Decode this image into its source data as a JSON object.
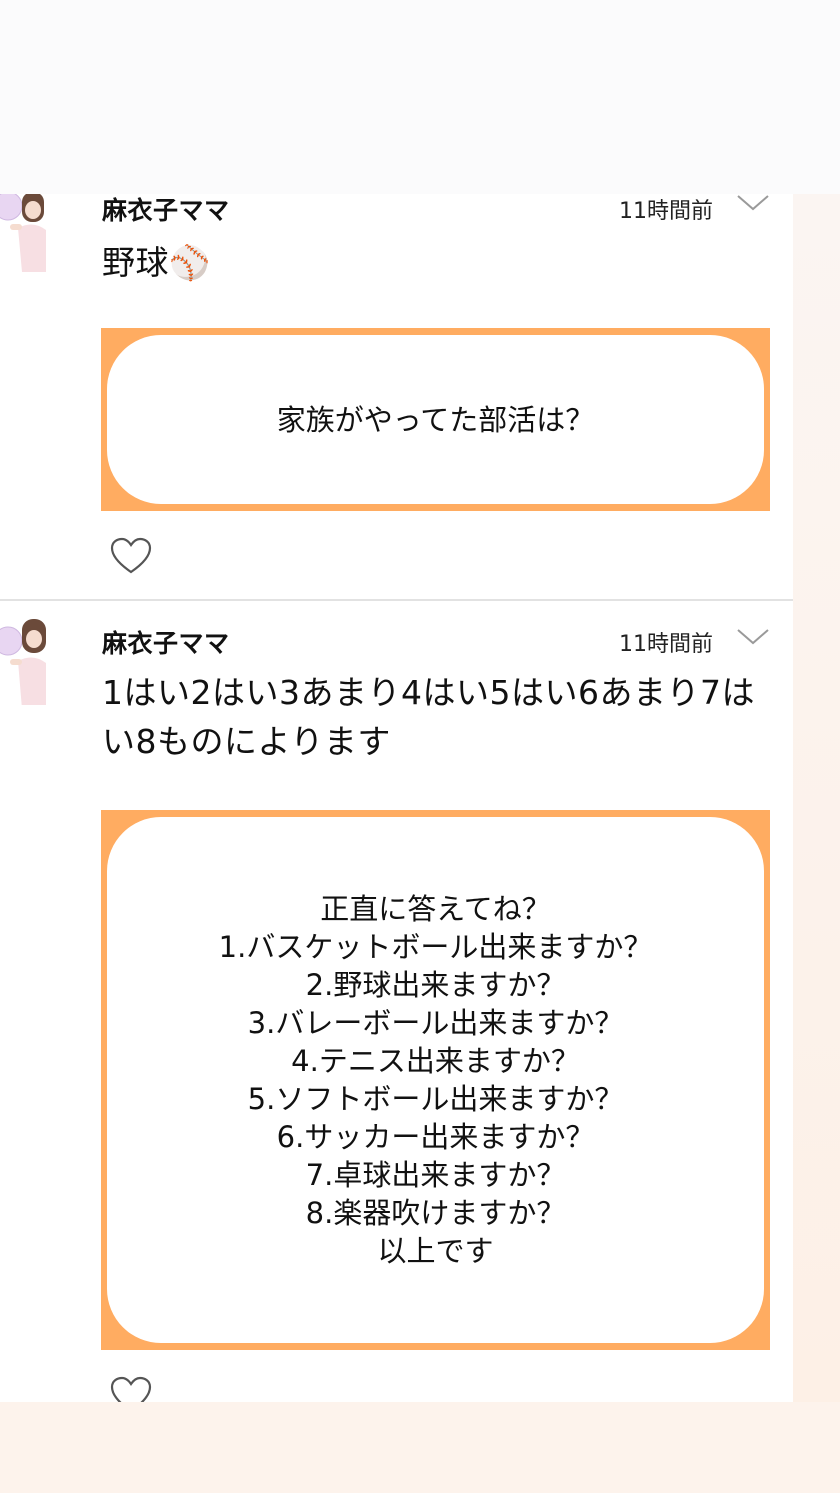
{
  "posts": [
    {
      "author": "麻衣子ママ",
      "time": "11時間前",
      "text": "野球⚾",
      "card_text": "家族がやってた部活は？",
      "avatar_icon": "avatar-photo",
      "more_icon": "chevron-down-icon",
      "like_icon": "heart-icon"
    },
    {
      "author": "麻衣子ママ",
      "time": "11時間前",
      "text": "1はい2はい3あまり4はい5はい6あまり7はい8ものによります",
      "card_text": "正直に答えてね？\n1.バスケットボール出来ますか？\n2.野球出来ますか？\n3.バレーボール出来ますか？\n4.テニス出来ますか？\n5.ソフトボール出来ますか？\n6.サッカー出来ますか？\n7.卓球出来ますか？\n8.楽器吹けますか？\n以上です",
      "avatar_icon": "avatar-photo",
      "more_icon": "chevron-down-icon",
      "like_icon": "heart-icon"
    }
  ],
  "colors": {
    "card_border": "#ffac61",
    "background": "#fdf3ec"
  }
}
